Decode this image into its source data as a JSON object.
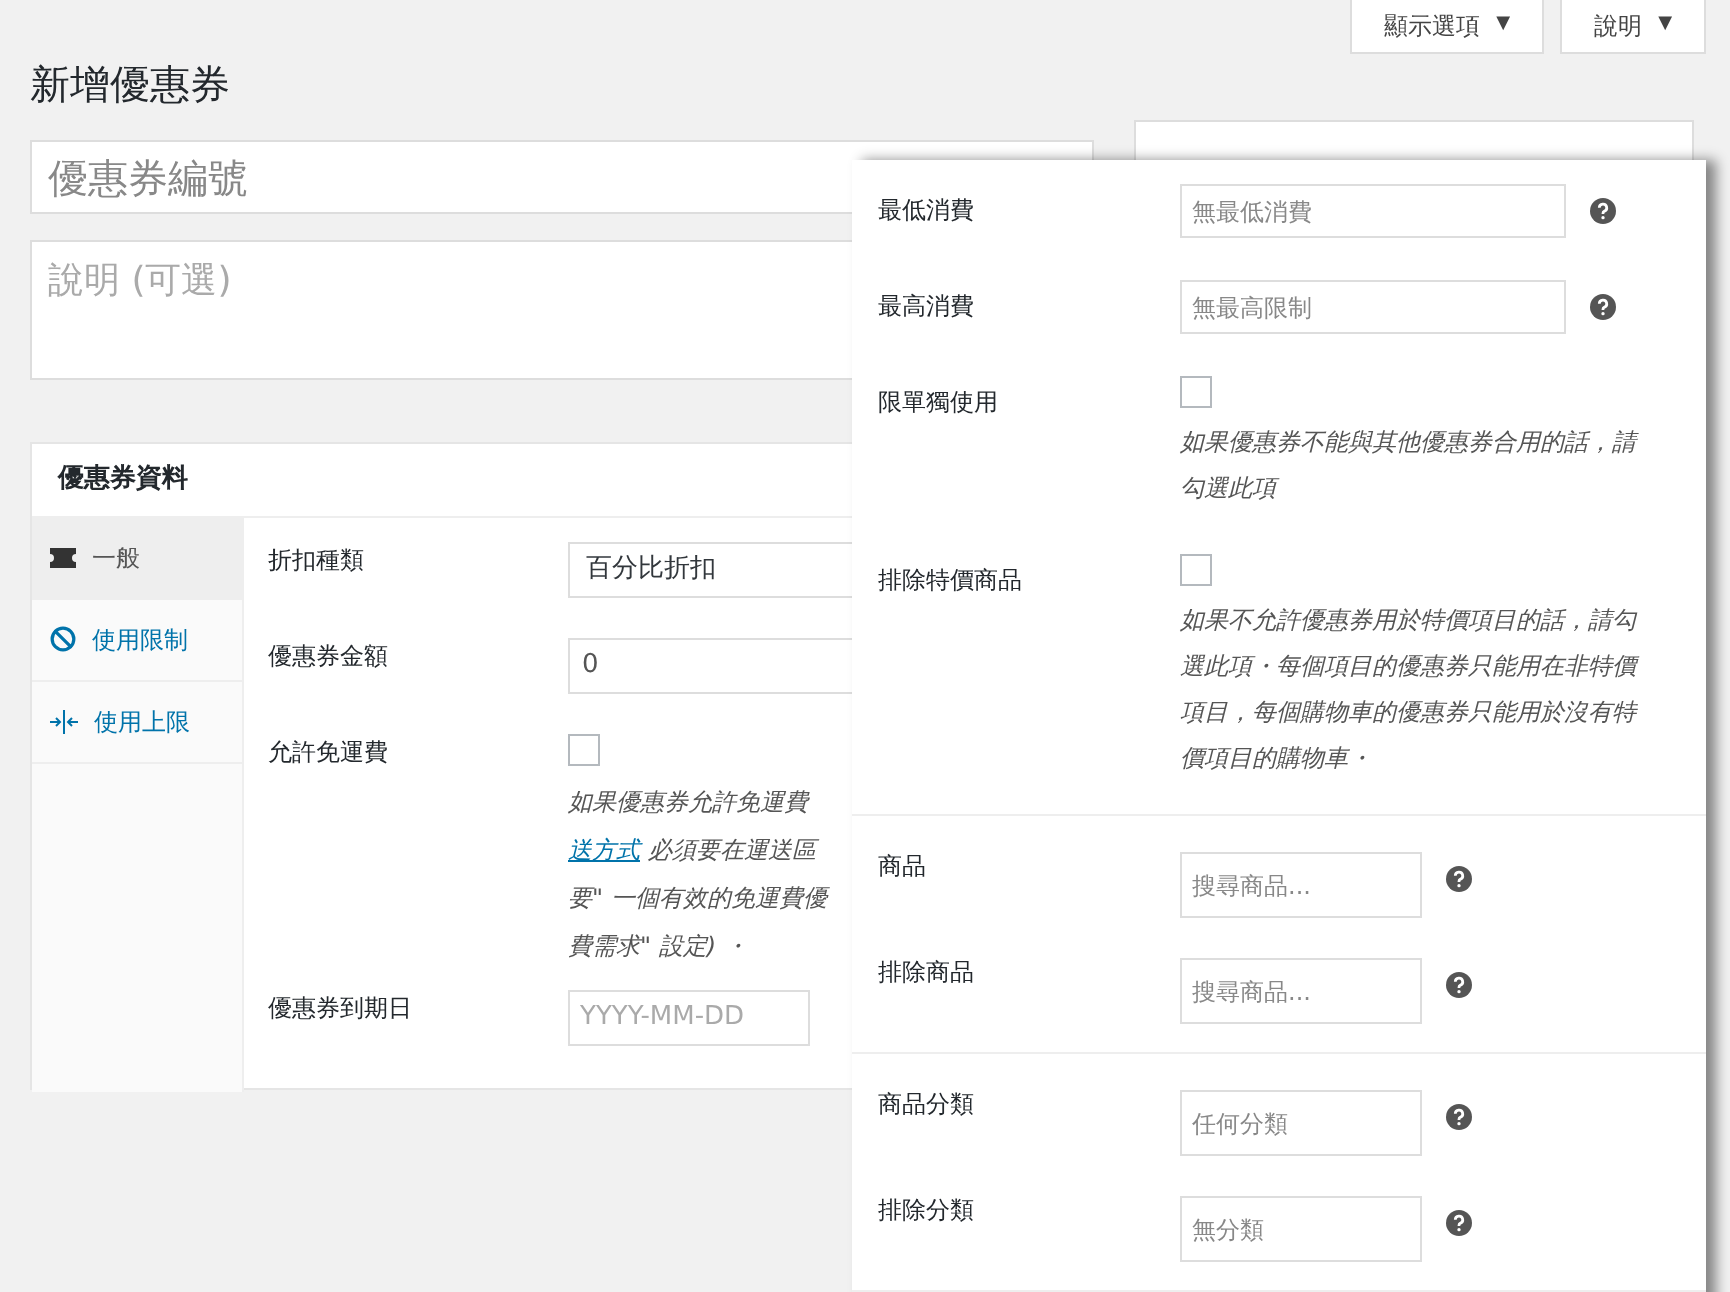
{
  "top_buttons": [
    {
      "label": "顯示選項",
      "caret": "▼"
    },
    {
      "label": "說明",
      "caret": "▼"
    }
  ],
  "page_title": "新增優惠券",
  "title_field": {
    "placeholder": "優惠券編號"
  },
  "description_field": {
    "placeholder": "說明 (可選)"
  },
  "coupon_data": {
    "title": "優惠券資料",
    "tabs": [
      {
        "label": "一般",
        "kind": "ticket",
        "selected": true
      },
      {
        "label": "使用限制",
        "kind": "block",
        "selected": false
      },
      {
        "label": "使用上限",
        "kind": "arrows",
        "selected": false
      }
    ],
    "fields": [
      {
        "label": "折扣種類",
        "kind": "select",
        "value": "百分比折扣"
      },
      {
        "label": "優惠券金額",
        "kind": "text",
        "value": "0"
      },
      {
        "label": "允許免運費",
        "kind": "checkbox",
        "checked": false,
        "description_lines": [
          {
            "text": "如果優惠券允許免運費"
          },
          {
            "link": "送方式",
            "text": " 必須要在運送區"
          },
          {
            "text": "要\" 一個有效的免運費優"
          },
          {
            "text": "費需求\" 設定) ・"
          }
        ]
      },
      {
        "label": "優惠券到期日",
        "kind": "date",
        "placeholder": "YYYY-MM-DD"
      }
    ]
  },
  "restrictions": {
    "sections": [
      [
        {
          "label": "最低消費",
          "kind": "wide",
          "placeholder": "無最低消費",
          "help": true
        },
        {
          "label": "最高消費",
          "kind": "wide",
          "placeholder": "無最高限制",
          "help": true
        },
        {
          "label": "限單獨使用",
          "kind": "checkbox",
          "checked": false,
          "description": "如果優惠券不能與其他優惠券合用的話，請勾選此項"
        },
        {
          "label": "排除特價商品",
          "kind": "checkbox",
          "checked": false,
          "description": "如果不允許優惠券用於特價項目的話，請勾選此項・每個項目的優惠券只能用在非特價項目，每個購物車的優惠券只能用於沒有特價項目的購物車・"
        }
      ],
      [
        {
          "label": "商品",
          "kind": "search",
          "placeholder": "搜尋商品...",
          "help": true
        },
        {
          "label": "排除商品",
          "kind": "search",
          "placeholder": "搜尋商品...",
          "help": true
        }
      ],
      [
        {
          "label": "商品分類",
          "kind": "search",
          "placeholder": "任何分類",
          "help": true
        },
        {
          "label": "排除分類",
          "kind": "search",
          "placeholder": "無分類",
          "help": true
        }
      ]
    ]
  }
}
